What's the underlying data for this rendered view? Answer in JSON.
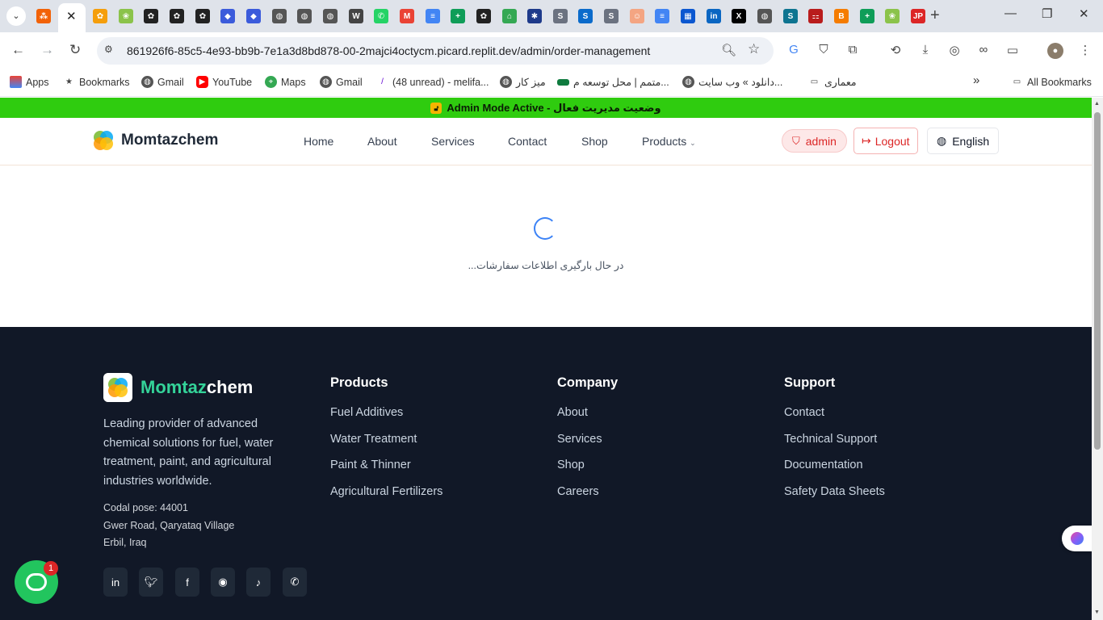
{
  "browser": {
    "tabs": [
      {
        "icon": "chatgpt-icon",
        "color": "#f59e0b"
      },
      {
        "icon": "replit-icon",
        "color": "#f26207"
      },
      {
        "icon": "momtazchem-icon",
        "color": "#8bc34a"
      },
      {
        "icon": "openai-icon",
        "color": "#222222"
      },
      {
        "icon": "openai-icon",
        "color": "#222222"
      },
      {
        "icon": "openai-icon",
        "color": "#222222"
      },
      {
        "icon": "copilot-icon",
        "color": "#3b5bdb"
      },
      {
        "icon": "copilot-icon",
        "color": "#3b5bdb"
      },
      {
        "icon": "globe-icon",
        "color": "#555555"
      },
      {
        "icon": "globe-icon",
        "color": "#555555"
      },
      {
        "icon": "globe-icon",
        "color": "#555555"
      },
      {
        "icon": "wikipedia-icon",
        "color": "#444444"
      },
      {
        "icon": "whatsapp-icon",
        "color": "#25d366"
      },
      {
        "icon": "gmail-icon",
        "color": "#ea4335"
      },
      {
        "icon": "docs-icon",
        "color": "#4285f4"
      },
      {
        "icon": "sheets-icon",
        "color": "#0f9d58"
      },
      {
        "icon": "openai-icon",
        "color": "#222222"
      },
      {
        "icon": "home-icon",
        "color": "#34a853"
      },
      {
        "icon": "asterisk-icon",
        "color": "#1e3a8a"
      },
      {
        "icon": "s-icon",
        "color": "#6b7280"
      },
      {
        "icon": "s-icon",
        "color": "#0b6bcb"
      },
      {
        "icon": "s-icon",
        "color": "#6b7280"
      },
      {
        "icon": "avatar-icon",
        "color": "#f4a582"
      },
      {
        "icon": "docs-icon",
        "color": "#4285f4"
      },
      {
        "icon": "teams-icon",
        "color": "#0b57d0"
      },
      {
        "icon": "linkedin-icon",
        "color": "#0a66c2"
      },
      {
        "icon": "x-icon",
        "color": "#000000"
      },
      {
        "icon": "globe-icon",
        "color": "#555555"
      },
      {
        "icon": "s-icon",
        "color": "#0e7490"
      },
      {
        "icon": "pdf-icon",
        "color": "#b91c1c"
      },
      {
        "icon": "blogger-icon",
        "color": "#f57c00"
      },
      {
        "icon": "sheets-icon",
        "color": "#0f9d58"
      },
      {
        "icon": "momtazchem-icon",
        "color": "#8bc34a"
      },
      {
        "icon": "jpgpng-icon",
        "color": "#dc2626"
      }
    ],
    "url": "861926f6-85c5-4e93-bb9b-7e1a3d8bd878-00-2majci4octycm.picard.replit.dev/admin/order-management",
    "bookmarks": [
      {
        "label": "Apps",
        "icon": "apps-grid-icon"
      },
      {
        "label": "Bookmarks",
        "icon": "star-icon"
      },
      {
        "label": "Gmail",
        "icon": "globe-icon"
      },
      {
        "label": "YouTube",
        "icon": "youtube-icon"
      },
      {
        "label": "Maps",
        "icon": "maps-icon"
      },
      {
        "label": "Gmail",
        "icon": "globe-icon"
      },
      {
        "label": "(48 unread) - melifa...",
        "icon": "yahoo-icon"
      },
      {
        "label": "میز کار",
        "icon": "globe-icon"
      },
      {
        "label": "متمم | محل توسعه م...",
        "icon": "motamem-icon"
      },
      {
        "label": "دانلود » وب سایت...",
        "icon": "globe-icon"
      },
      {
        "label": "معماری",
        "icon": "folder-icon"
      },
      {
        "label": "All Bookmarks",
        "icon": "folder-icon"
      }
    ],
    "overflow_label": "»"
  },
  "banner": {
    "text": "وضعیت مدیریت فعال - Admin Mode Active"
  },
  "header": {
    "brand": "Momtazchem",
    "nav": [
      "Home",
      "About",
      "Services",
      "Contact",
      "Shop",
      "Products"
    ],
    "admin_label": "admin",
    "logout_label": "Logout",
    "language_label": "English"
  },
  "main": {
    "loading_text": "در حال بارگیری اطلاعات سفارشات..."
  },
  "footer": {
    "brand_a": "Momtaz",
    "brand_b": "chem",
    "description": "Leading provider of advanced chemical solutions for fuel, water treatment, paint, and agricultural industries worldwide.",
    "address": [
      "Codal pose: 44001",
      "Gwer Road, Qaryataq Village",
      "Erbil, Iraq"
    ],
    "columns": [
      {
        "title": "Products",
        "links": [
          "Fuel Additives",
          "Water Treatment",
          "Paint & Thinner",
          "Agricultural Fertilizers"
        ]
      },
      {
        "title": "Company",
        "links": [
          "About",
          "Services",
          "Shop",
          "Careers"
        ]
      },
      {
        "title": "Support",
        "links": [
          "Contact",
          "Technical Support",
          "Documentation",
          "Safety Data Sheets"
        ]
      }
    ],
    "socials": [
      "linkedin-icon",
      "twitter-icon",
      "facebook-icon",
      "instagram-icon",
      "tiktok-icon",
      "whatsapp-icon"
    ]
  },
  "chat": {
    "unread_count": "1"
  },
  "colors": {
    "banner": "#2fcc0f",
    "footer_bg": "#111827",
    "accent_green": "#34d399",
    "danger": "#dc2626"
  }
}
